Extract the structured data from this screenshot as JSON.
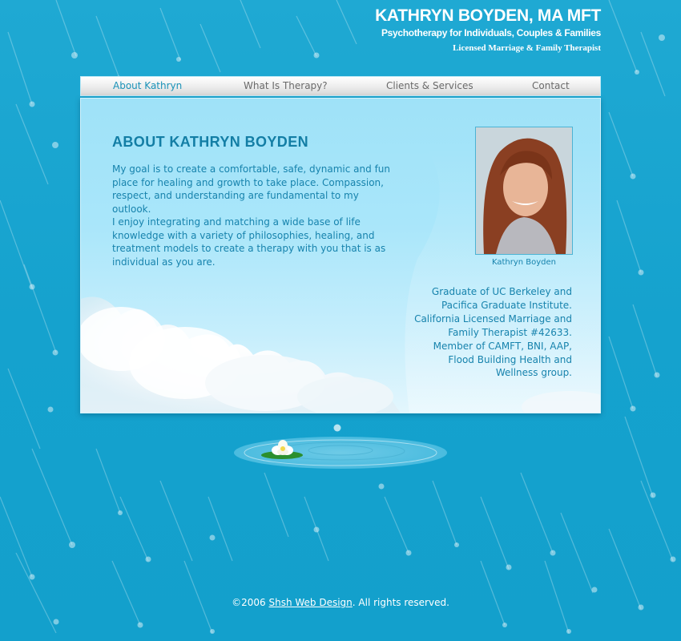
{
  "header": {
    "title": "KATHRYN BOYDEN, MA MFT",
    "tagline": "Psychotherapy for Individuals, Couples & Families",
    "license": "Licensed Marriage & Family Therapist"
  },
  "nav": {
    "items": [
      {
        "label": "About Kathryn",
        "active": true
      },
      {
        "label": "What Is Therapy?"
      },
      {
        "label": "Clients & Services"
      },
      {
        "label": "Contact"
      }
    ]
  },
  "main": {
    "title": "ABOUT KATHRYN BOYDEN",
    "paragraph_1": "My goal is to create a comfortable, safe, dynamic and fun place for healing and growth to take place. Compassion, respect, and understanding are fundamental to my outlook.",
    "paragraph_2": "I enjoy integrating and matching a wide base of life knowledge with a variety of philosophies, healing, and treatment models to create a therapy with you that is as individual as you are.",
    "photo_caption": "Kathryn Boyden",
    "credentials": "Graduate of UC Berkeley and Pacifica Graduate Institute. California Licensed Marriage and Family Therapist #42633. Member of CAMFT, BNI, AAP, Flood Building Health and Wellness group."
  },
  "footer": {
    "copyright": "©2006",
    "link_text": "Shsh Web Design",
    "rights": ".  All rights reserved."
  },
  "colors": {
    "background": "#15a2ce",
    "accent": "#137ea5",
    "body_text": "#1783ad",
    "nav_active": "#1a92b8",
    "nav_text": "#6a6a6a"
  }
}
